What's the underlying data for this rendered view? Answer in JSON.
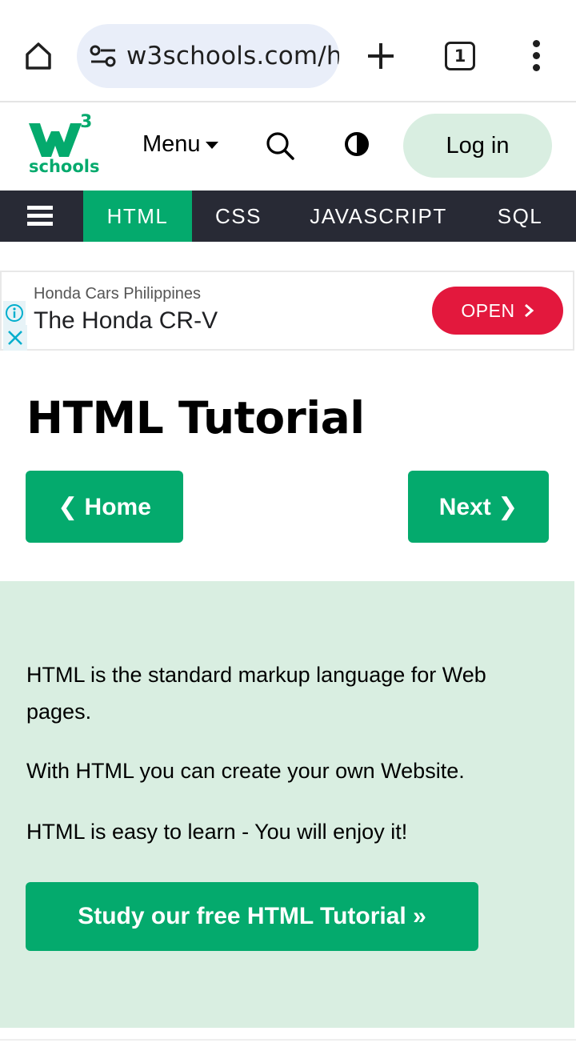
{
  "browser": {
    "url": "w3schools.com/h",
    "tab_count": "1"
  },
  "header": {
    "logo_superscript": "3",
    "logo_word": "schools",
    "menu_label": "Menu",
    "login_label": "Log in"
  },
  "topnav": {
    "items": [
      {
        "label": "HTML",
        "active": true
      },
      {
        "label": "CSS"
      },
      {
        "label": "JAVASCRIPT"
      },
      {
        "label": "SQL"
      }
    ]
  },
  "ad": {
    "sponsor": "Honda Cars Philippines",
    "headline": "The Honda CR-V",
    "cta": "OPEN"
  },
  "main": {
    "title": "HTML Tutorial",
    "home_button": "❮ Home",
    "next_button": "Next ❯"
  },
  "intro": {
    "p1": "HTML is the standard markup language for Web pages.",
    "p2": "With HTML you can create your own Website.",
    "p3": "HTML is easy to learn - You will enjoy it!",
    "study_button": "Study our free HTML Tutorial »"
  },
  "colors": {
    "brand_green": "#04aa6d",
    "nav_dark": "#282a35",
    "intro_bg": "#d9eee1",
    "ad_cta": "#e3183d"
  }
}
